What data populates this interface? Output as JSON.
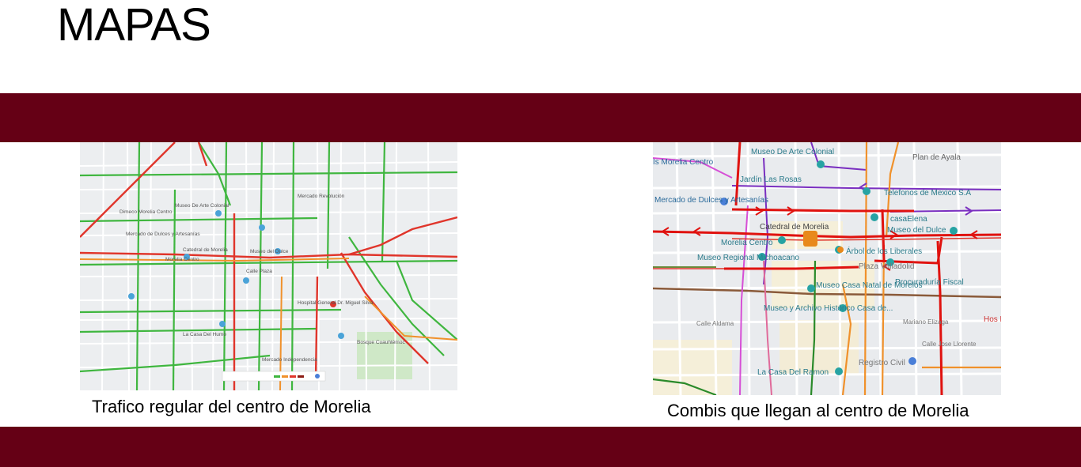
{
  "slide": {
    "title": "MAPAS",
    "accent_color": "#650015"
  },
  "map_left": {
    "caption": "Trafico regular del centro de Morelia",
    "labels": [
      "Museo De Arte Colonial",
      "Mercado Revolución",
      "Dimeco Morelia Centro",
      "Catedral de Morelia",
      "Morelia Centro",
      "Museo del Dulce",
      "Calle Plaza",
      "Mercado de Dulces y Artesanías",
      "La Casa Del Humo",
      "Mercado Independencia",
      "Hospital General Dr. Miguel Silva",
      "Bosque Cuauhtémoc"
    ]
  },
  "map_right": {
    "caption": "Combis que llegan al centro de Morelia",
    "labels": [
      "Museo De Arte Colonial",
      "Plan de Ayala",
      "Telefonos de Mexico S.A",
      "Jardín Las Rosas",
      "Mercado de Dulces y Artesanías",
      "casaElena",
      "Catedral de Morelia",
      "Museo del Dulce",
      "Morelia Centro",
      "Árbol de los Liberales",
      "Museo Regional Michoacano",
      "Plaza Valladolid",
      "Procuraduría Fiscal",
      "Museo Casa Natal de Morelos",
      "Museo y Archivo Histórico Casa de...",
      "Calle Aldama",
      "Mariano Elizaga",
      "Calle Jose Llorente",
      "Registro Civil",
      "La Casa Del Ramon",
      "Is Morelia Centro",
      "Hos Dr."
    ]
  }
}
